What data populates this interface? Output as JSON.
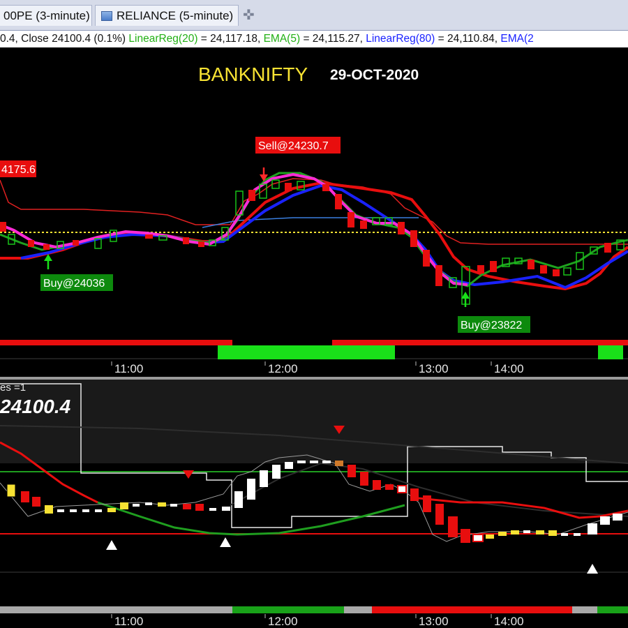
{
  "tabs": [
    {
      "label": "00PE (3-minute)"
    },
    {
      "label": "RELIANCE (5-minute)"
    }
  ],
  "add_tab_icon": "plus-icon",
  "legend": {
    "ohlc": "0.4, Close 24100.4 (0.1%)",
    "lr20": "LinearReg(20)",
    "lr20_value": " = 24,117.18,",
    "ema5": "EMA(5)",
    "ema5_value": " = 24,115.27,",
    "lr80": "LinearReg(80)",
    "lr80_value": " = 24,110.84,",
    "ema2": "EMA(2",
    "colors": {
      "lr20": "#22b014",
      "ema5": "#22b014",
      "lr80": "#1a22ff",
      "ema2": "#1a22ff"
    }
  },
  "chart": {
    "title": "BANKNIFTY",
    "date": "29-OCT-2020",
    "title_color": "#f7e233",
    "signals": [
      {
        "text": "4175.6",
        "kind": "sell"
      },
      {
        "text": "Sell@24230.7",
        "kind": "sell"
      },
      {
        "text": "Buy@24036",
        "kind": "buy"
      },
      {
        "text": "Buy@23822",
        "kind": "buy"
      }
    ],
    "time_labels": [
      "11:00",
      "12:00",
      "13:00",
      "14:00"
    ],
    "lower_time_labels": [
      "11:00",
      "12:00",
      "13:00",
      "14:00"
    ]
  },
  "lower": {
    "series_label": "es =1",
    "price": "24100.4"
  }
}
